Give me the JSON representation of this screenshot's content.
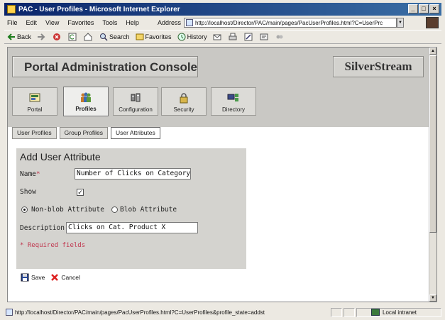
{
  "window": {
    "title": "PAC - User Profiles - Microsoft Internet Explorer"
  },
  "menu": [
    "File",
    "Edit",
    "View",
    "Favorites",
    "Tools",
    "Help"
  ],
  "address": {
    "label": "Address",
    "url": "http://localhost/Director/PAC/main/pages/PacUserProfiles.html?C=UserPrc"
  },
  "toolbar": {
    "back": "Back",
    "search": "Search",
    "favorites": "Favorites",
    "history": "History"
  },
  "banner": {
    "title": "Portal Administration Console",
    "brand": "SilverStream"
  },
  "nav_tabs": [
    {
      "label": "Portal",
      "icon": "portal-icon",
      "active": false
    },
    {
      "label": "Profiles",
      "icon": "profiles-icon",
      "active": true
    },
    {
      "label": "Configuration",
      "icon": "configuration-icon",
      "active": false
    },
    {
      "label": "Security",
      "icon": "security-icon",
      "active": false
    },
    {
      "label": "Directory",
      "icon": "directory-icon",
      "active": false
    }
  ],
  "sub_tabs": [
    {
      "label": "User Profiles",
      "active": false
    },
    {
      "label": "Group Profiles",
      "active": false
    },
    {
      "label": "User Attributes",
      "active": true
    }
  ],
  "form": {
    "title": "Add User Attribute",
    "name_label": "Name",
    "required_marker": "*",
    "name_value": "Number of Clicks on Category",
    "show_label": "Show",
    "show_checked": true,
    "radio_nonblob": "Non-blob Attribute",
    "radio_blob": "Blob Attribute",
    "radio_selected": "nonblob",
    "description_label": "Description",
    "description_value": "Clicks on Cat. Product X",
    "required_note": "* Required fields"
  },
  "actions": {
    "save": "Save",
    "cancel": "Cancel"
  },
  "status": {
    "text": "http://localhost/Director/PAC/main/pages/PacUserProfiles.html?C=UserProfiles&profile_state=addst",
    "zone": "Local intranet"
  },
  "colors": {
    "required": "#c0364e",
    "titlebar": "#0a246a",
    "header_band": "#c9c8c4"
  }
}
